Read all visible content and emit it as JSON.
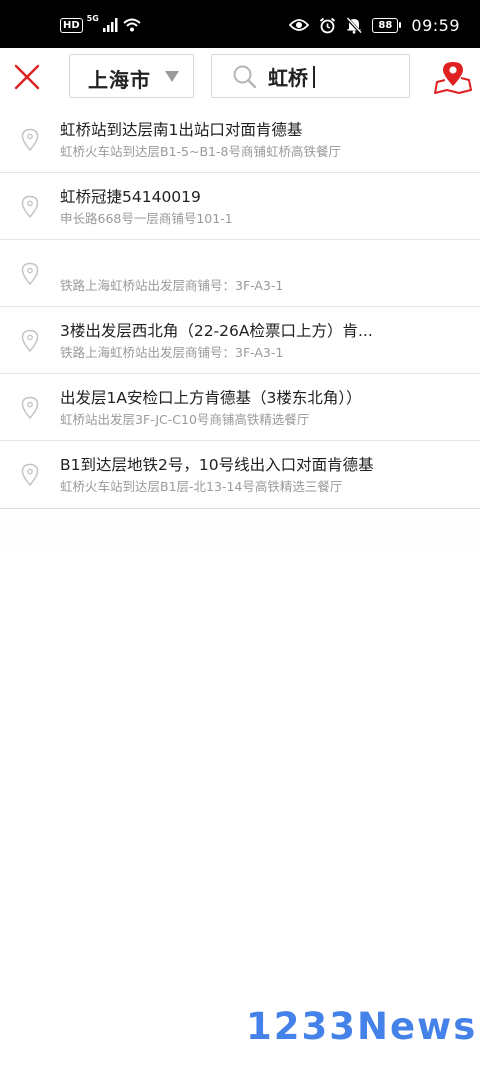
{
  "status_bar": {
    "hd": "HD",
    "network": "5G",
    "battery": "88",
    "time": "09:59",
    "icons": [
      "signal-icon",
      "wifi-icon",
      "eye-icon",
      "alarm-icon",
      "mute-bell-icon",
      "battery-icon"
    ]
  },
  "header": {
    "city": "上海市",
    "search_value": "虹桥",
    "accent_color": "#e02020"
  },
  "results": [
    {
      "title": "虹桥站到达层南1出站口对面肯德基",
      "subtitle": "虹桥火车站到达层B1-5~B1-8号商铺虹桥高铁餐厅"
    },
    {
      "title": "虹桥冠捷54140019",
      "subtitle": "申长路668号一层商铺号101-1"
    },
    {
      "title": "",
      "subtitle": "铁路上海虹桥站出发层商铺号：3F-A3-1"
    },
    {
      "title": "3楼出发层西北角（22-26A检票口上方）肯...",
      "subtitle": "铁路上海虹桥站出发层商铺号：3F-A3-1"
    },
    {
      "title": "出发层1A安检口上方肯德基（3楼东北角））",
      "subtitle": "虹桥站出发层3F-JC-C10号商铺高铁精选餐厅"
    },
    {
      "title": "B1到达层地铁2号，10号线出入口对面肯德基",
      "subtitle": "虹桥火车站到达层B1层-北13-14号高铁精选三餐厅"
    }
  ],
  "watermark": "1233News"
}
